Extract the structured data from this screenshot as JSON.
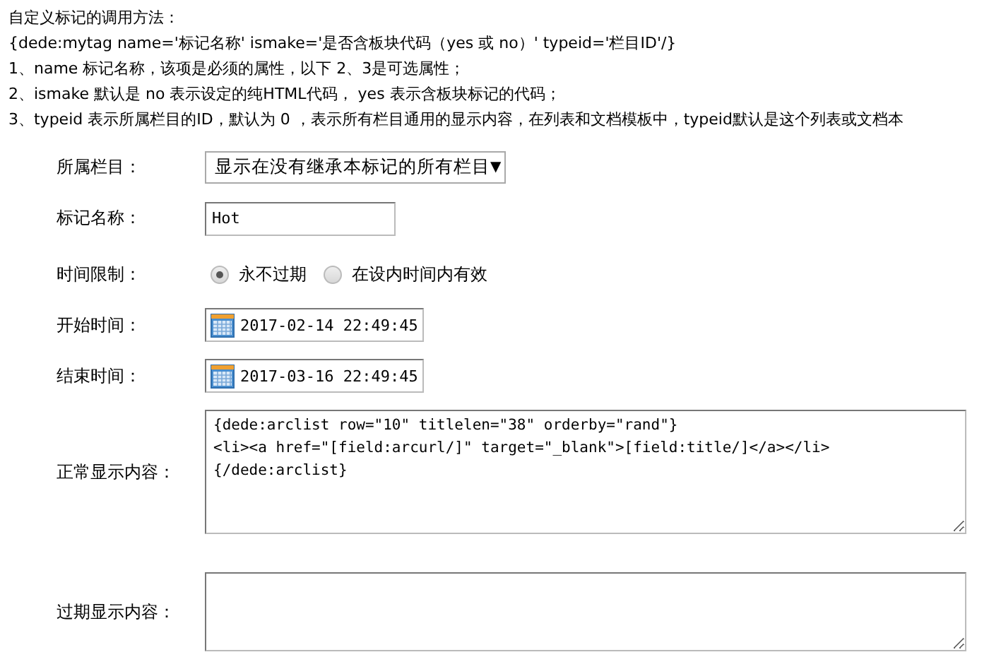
{
  "intro": {
    "title": "自定义标记的调用方法：",
    "lines": [
      "{dede:mytag name='标记名称' ismake='是否含板块代码（yes 或 no）' typeid='栏目ID'/}",
      "1、name 标记名称，该项是必须的属性，以下 2、3是可选属性；",
      "2、ismake 默认是 no 表示设定的纯HTML代码， yes 表示含板块标记的代码；",
      "3、typeid 表示所属栏目的ID，默认为 0 ，表示所有栏目通用的显示内容，在列表和文档模板中，typeid默认是这个列表或文档本"
    ]
  },
  "form": [
    {
      "kind": "select",
      "label": "所属栏目：",
      "value": "显示在没有继承本标记的所有栏目",
      "caret": "▼"
    },
    {
      "kind": "text",
      "label": "标记名称：",
      "value": "Hot"
    },
    {
      "kind": "radio",
      "label": "时间限制：",
      "options": [
        {
          "label": "永不过期",
          "selected": true
        },
        {
          "label": "在设内时间内有效",
          "selected": false
        }
      ]
    },
    {
      "kind": "date",
      "label": "开始时间：",
      "value": "2017-02-14 22:49:45"
    },
    {
      "kind": "date",
      "label": "结束时间：",
      "value": "2017-03-16 22:49:45"
    },
    {
      "kind": "textarea",
      "label": "正常显示内容：",
      "value": "{dede:arclist row=\"10\" titlelen=\"38\" orderby=\"rand\"}\n<li><a href=\"[field:arcurl/]\" target=\"_blank\">[field:title/]</a></li>\n{/dede:arclist}"
    },
    {
      "kind": "textarea",
      "label": "过期显示内容："
    }
  ]
}
